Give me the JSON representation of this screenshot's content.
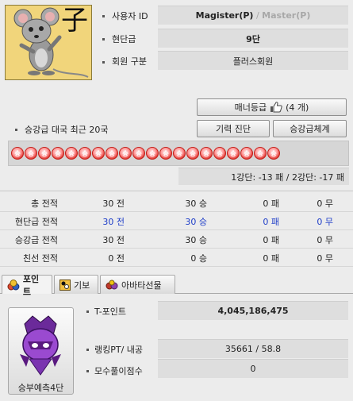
{
  "profile": {
    "avatar_char": "子",
    "user_id_label": "사용자 ID",
    "user_id_value": "Magister(P)",
    "user_id_sep": " / ",
    "user_id_alt": "Master(P)",
    "rank_label": "현단급",
    "rank_value": "9단",
    "member_type_label": "회원 구분",
    "member_type_value": "플러스회원"
  },
  "buttons": {
    "manner_label": "매너등급",
    "manner_count": "(4 개)",
    "skill_check": "기력 진단",
    "promotion_system": "승강급체계"
  },
  "recent_games": {
    "title": "승강급 대국 최근 20국",
    "results": [
      "승",
      "승",
      "승",
      "승",
      "승",
      "승",
      "승",
      "승",
      "승",
      "승",
      "승",
      "승",
      "승",
      "승",
      "승",
      "승",
      "승",
      "승",
      "승",
      "승"
    ],
    "summary": "1강단: -13 패 / 2강단: -17 패"
  },
  "stats": {
    "rows": [
      {
        "label": "총 전적",
        "games": "30 전",
        "wins": "30 승",
        "losses": "0 패",
        "draws": "0 무",
        "highlight": false
      },
      {
        "label": "현단급 전적",
        "games": "30 전",
        "wins": "30 승",
        "losses": "0 패",
        "draws": "0 무",
        "highlight": true
      },
      {
        "label": "승강급 전적",
        "games": "30 전",
        "wins": "30 승",
        "losses": "0 패",
        "draws": "0 무",
        "highlight": false
      },
      {
        "label": "친선 전적",
        "games": "0 전",
        "wins": "0 승",
        "losses": "0 패",
        "draws": "0 무",
        "highlight": false
      }
    ]
  },
  "tabs": [
    {
      "label": "포인트",
      "icon": "coins-icon"
    },
    {
      "label": "기보",
      "icon": "record-icon"
    },
    {
      "label": "아바타선물",
      "icon": "gift-icon"
    }
  ],
  "points": {
    "portrait_caption": "승부예측4단",
    "tpoint_label": "T-포인트",
    "tpoint_value": "4,045,186,475",
    "ranking_label": "랭킹PT/ 내공",
    "ranking_value": "35661 / 58.8",
    "mosu_label": "모수풀이점수",
    "mosu_value": "0"
  },
  "colors": {
    "accent_blue": "#1f3ec8",
    "win_red": "#e0342e",
    "avatar_bg": "#f1d57b"
  }
}
